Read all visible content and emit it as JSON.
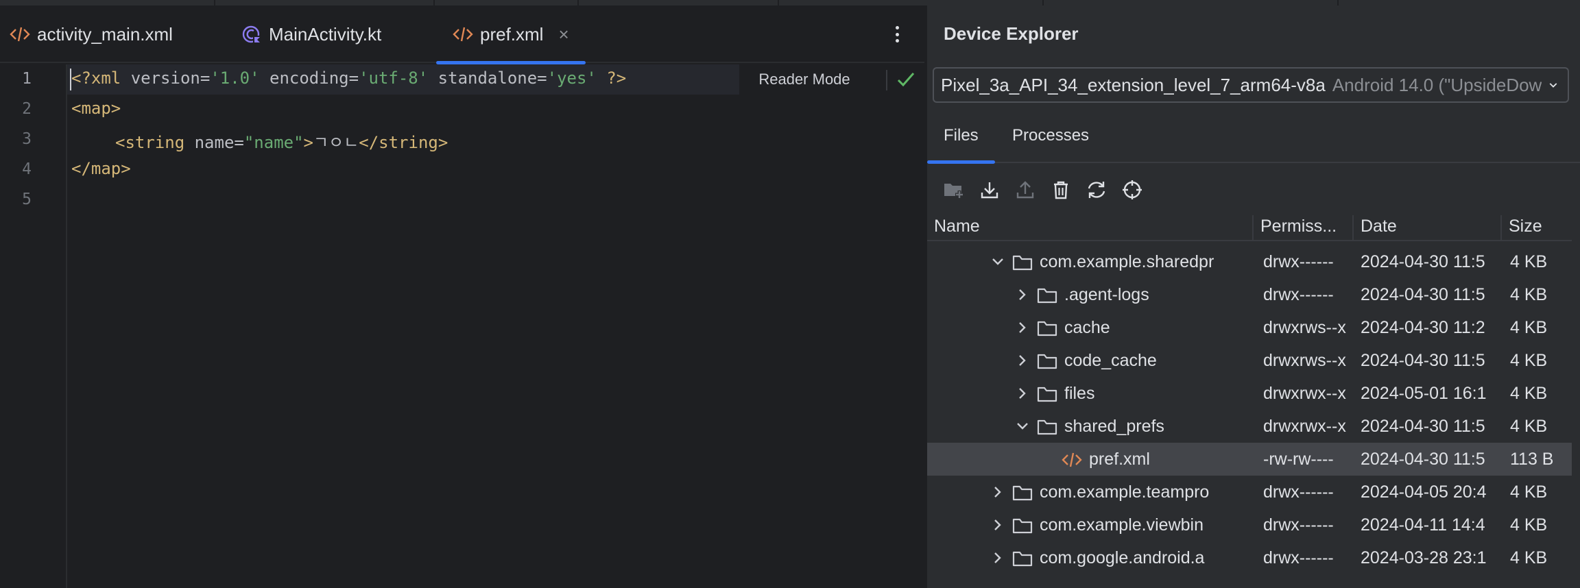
{
  "editor": {
    "tabs": [
      {
        "label": "activity_main.xml"
      },
      {
        "label": "MainActivity.kt"
      },
      {
        "label": "pref.xml",
        "close": "×"
      }
    ],
    "line_numbers": [
      "1",
      "2",
      "3",
      "4",
      "5"
    ],
    "code": {
      "l1": {
        "open": "<?xml ",
        "a1": "version",
        "eq1": "=",
        "v1": "'1.0'",
        "a2": " encoding",
        "eq2": "=",
        "v2": "'utf-8'",
        "a3": " standalone",
        "eq3": "=",
        "v3": "'yes'",
        "close": " ?>"
      },
      "l2": {
        "tag": "<map>"
      },
      "l3": {
        "open": "<string ",
        "attr": "name",
        "eq": "=",
        "val": "\"name\"",
        "gt": ">",
        "text": "ㄱㅇㄴ",
        "close": "</string>"
      },
      "l4": {
        "tag": "</map>"
      }
    },
    "reader_mode": "Reader Mode"
  },
  "device_explorer": {
    "title": "Device Explorer",
    "device": {
      "name": "Pixel_3a_API_34_extension_level_7_arm64-v8a",
      "os": "Android 14.0 (\"UpsideDown"
    },
    "tabs": [
      "Files",
      "Processes"
    ],
    "toolbar_icons": [
      "new-folder-icon",
      "download-icon",
      "upload-icon",
      "delete-icon",
      "sync-icon",
      "locate-icon"
    ],
    "columns": [
      "Name",
      "Permiss...",
      "Date",
      "Size"
    ],
    "rows": [
      {
        "name": "com.example.sharedpr",
        "perm": "drwx------",
        "date": "2024-04-30 11:5",
        "size": "4 KB",
        "depth": 0,
        "expanded": true,
        "type": "folder"
      },
      {
        "name": ".agent-logs",
        "perm": "drwx------",
        "date": "2024-04-30 11:5",
        "size": "4 KB",
        "depth": 1,
        "expanded": false,
        "type": "folder"
      },
      {
        "name": "cache",
        "perm": "drwxrws--x",
        "date": "2024-04-30 11:2",
        "size": "4 KB",
        "depth": 1,
        "expanded": false,
        "type": "folder"
      },
      {
        "name": "code_cache",
        "perm": "drwxrws--x",
        "date": "2024-04-30 11:5",
        "size": "4 KB",
        "depth": 1,
        "expanded": false,
        "type": "folder"
      },
      {
        "name": "files",
        "perm": "drwxrwx--x",
        "date": "2024-05-01 16:1",
        "size": "4 KB",
        "depth": 1,
        "expanded": false,
        "type": "folder"
      },
      {
        "name": "shared_prefs",
        "perm": "drwxrwx--x",
        "date": "2024-04-30 11:5",
        "size": "4 KB",
        "depth": 1,
        "expanded": true,
        "type": "folder"
      },
      {
        "name": "pref.xml",
        "perm": "-rw-rw----",
        "date": "2024-04-30 11:5",
        "size": "113 B",
        "depth": 2,
        "type": "xml",
        "selected": true
      },
      {
        "name": "com.example.teampro",
        "perm": "drwx------",
        "date": "2024-04-05 20:4",
        "size": "4 KB",
        "depth": 0,
        "expanded": false,
        "type": "folder"
      },
      {
        "name": "com.example.viewbin",
        "perm": "drwx------",
        "date": "2024-04-11 14:4",
        "size": "4 KB",
        "depth": 0,
        "expanded": false,
        "type": "folder"
      },
      {
        "name": "com.google.android.a",
        "perm": "drwx------",
        "date": "2024-03-28 23:1",
        "size": "4 KB",
        "depth": 0,
        "expanded": false,
        "type": "folder"
      }
    ]
  },
  "colors": {
    "accent": "#3574f0",
    "xml_icon": "#e08855",
    "kotlin_icon": "#8c7cf0",
    "check": "#5fb865"
  }
}
